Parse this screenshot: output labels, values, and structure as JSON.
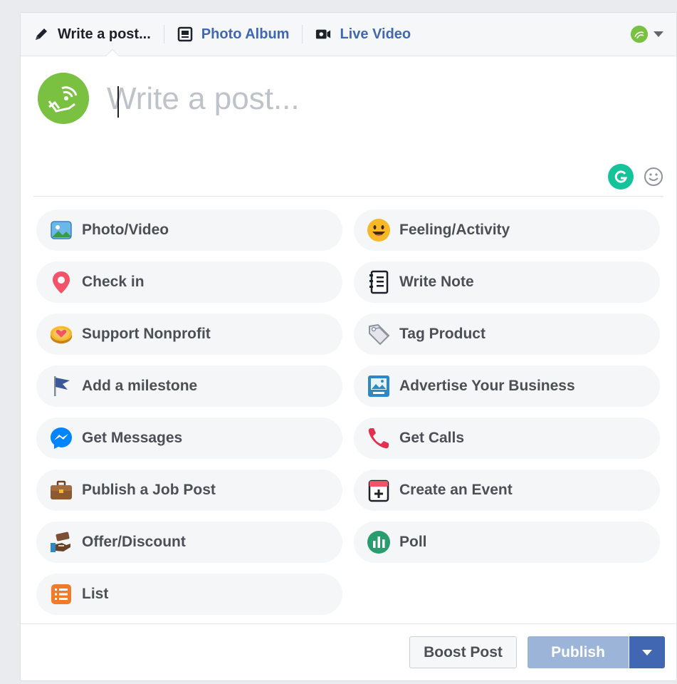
{
  "tabs": {
    "write": "Write a post...",
    "photo_album": "Photo Album",
    "live_video": "Live Video"
  },
  "composer": {
    "placeholder": "Write a post..."
  },
  "actions": {
    "photo_video": "Photo/Video",
    "feeling_activity": "Feeling/Activity",
    "check_in": "Check in",
    "write_note": "Write Note",
    "support_nonprofit": "Support Nonprofit",
    "tag_product": "Tag Product",
    "add_milestone": "Add a milestone",
    "advertise_business": "Advertise Your Business",
    "get_messages": "Get Messages",
    "get_calls": "Get Calls",
    "publish_job_post": "Publish a Job Post",
    "create_event": "Create an Event",
    "offer_discount": "Offer/Discount",
    "poll": "Poll",
    "list": "List"
  },
  "footer": {
    "boost_post": "Boost Post",
    "publish": "Publish"
  },
  "colors": {
    "link_blue": "#4267b2",
    "publish_disabled": "#9cb4d8",
    "avatar_green": "#7ac142",
    "grammarly_green": "#15c39a"
  }
}
